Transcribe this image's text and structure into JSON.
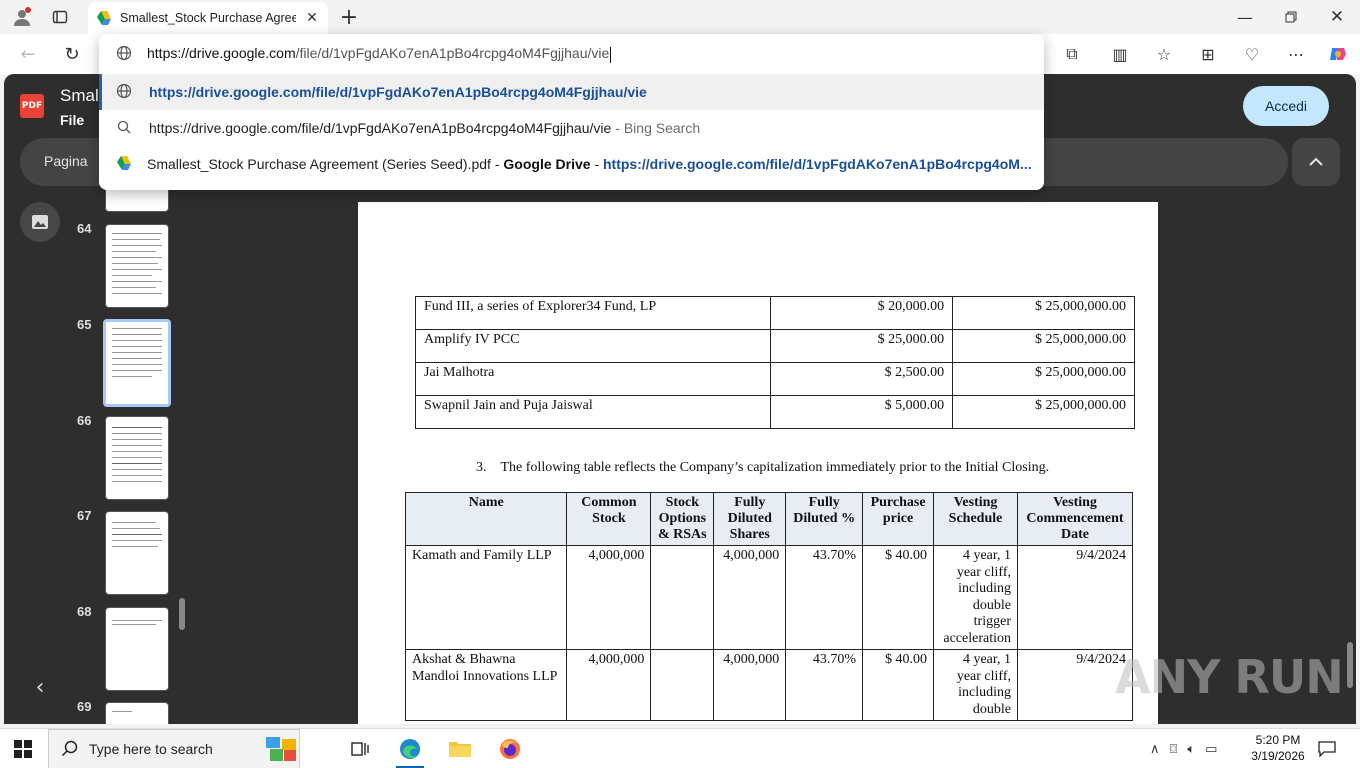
{
  "browser": {
    "tab_title": "Smallest_Stock Purchase Agreement (Series Seed).pdf",
    "address_host": "https://drive.google.com",
    "address_path": "/file/d/1vpFgdAKo7enA1pBo4rcpg4oM4Fgjjhau/vie",
    "suggestions": [
      {
        "text": "https://drive.google.com/file/d/1vpFgdAKo7enA1pBo4rcpg4oM4Fgjjhau/vie"
      },
      {
        "text": "https://drive.google.com/file/d/1vpFgdAKo7enA1pBo4rcpg4oM4Fgjjhau/vie",
        "suffix": "- Bing Search"
      },
      {
        "title": "Smallest_Stock Purchase Agreement (Series Seed).pdf",
        "sep": "-",
        "source": "Google Drive",
        "sep2": "-",
        "url": "https://drive.google.com/file/d/1vpFgdAKo7enA1pBo4rcpg4oM..."
      }
    ]
  },
  "viewer": {
    "badge": "PDF",
    "doc_title": "Smal",
    "file_menu": "File",
    "access_button": "Accedi",
    "page_label": "Pagina",
    "thumbnails": [
      "64",
      "65",
      "66",
      "67",
      "68",
      "69"
    ],
    "active_thumbnail": "65"
  },
  "page": {
    "table1": [
      [
        "Fund III, a series of Explorer34 Fund, LP",
        "$ 20,000.00",
        "$ 25,000,000.00"
      ],
      [
        "Amplify IV PCC",
        "$ 25,000.00",
        "$ 25,000,000.00"
      ],
      [
        "Jai Malhotra",
        "$ 2,500.00",
        "$ 25,000,000.00"
      ],
      [
        "Swapnil Jain and Puja Jaiswal",
        "$ 5,000.00",
        "$ 25,000,000.00"
      ]
    ],
    "paragraph": "3. The following table reflects the Company’s capitalization immediately prior to the Initial Closing.",
    "table2_headers": [
      "Name",
      "Common Stock",
      "Stock Options & RSAs",
      "Fully Diluted Shares",
      "Fully Diluted %",
      "Purchase price",
      "Vesting Schedule",
      "Vesting Commencement Date"
    ],
    "table2_rows": [
      [
        "Kamath and Family LLP",
        "4,000,000",
        "",
        "4,000,000",
        "43.70%",
        "$ 40.00",
        "4 year, 1 year cliff, including double trigger acceleration",
        "9/4/2024"
      ],
      [
        "Akshat & Bhawna Mandloi Innovations LLP",
        "4,000,000",
        "",
        "4,000,000",
        "43.70%",
        "$ 40.00",
        "4 year, 1 year cliff, including double",
        "9/4/2024"
      ]
    ]
  },
  "watermark": "ANY RUN",
  "taskbar": {
    "search_placeholder": "Type here to search",
    "time": "5:20 PM",
    "date": "3/19/2026"
  }
}
